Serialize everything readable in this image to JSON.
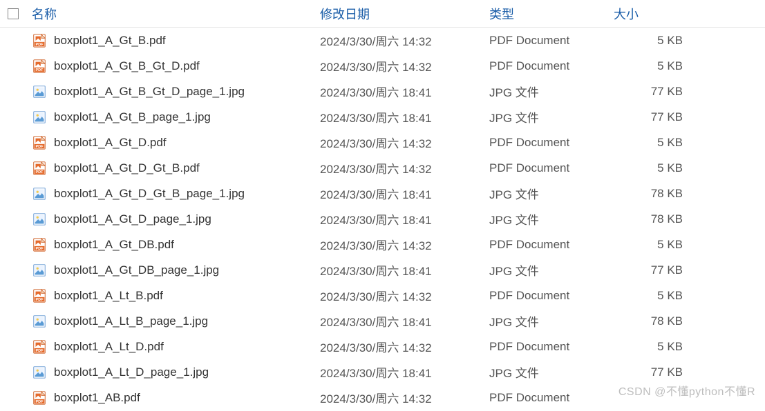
{
  "columns": {
    "name": "名称",
    "date": "修改日期",
    "type": "类型",
    "size": "大小"
  },
  "files": [
    {
      "icon": "pdf",
      "name": "boxplot1_A_Gt_B.pdf",
      "date": "2024/3/30/周六 14:32",
      "type": "PDF Document",
      "size": "5 KB"
    },
    {
      "icon": "pdf",
      "name": "boxplot1_A_Gt_B_Gt_D.pdf",
      "date": "2024/3/30/周六 14:32",
      "type": "PDF Document",
      "size": "5 KB"
    },
    {
      "icon": "jpg",
      "name": "boxplot1_A_Gt_B_Gt_D_page_1.jpg",
      "date": "2024/3/30/周六 18:41",
      "type": "JPG 文件",
      "size": "77 KB"
    },
    {
      "icon": "jpg",
      "name": "boxplot1_A_Gt_B_page_1.jpg",
      "date": "2024/3/30/周六 18:41",
      "type": "JPG 文件",
      "size": "77 KB"
    },
    {
      "icon": "pdf",
      "name": "boxplot1_A_Gt_D.pdf",
      "date": "2024/3/30/周六 14:32",
      "type": "PDF Document",
      "size": "5 KB"
    },
    {
      "icon": "pdf",
      "name": "boxplot1_A_Gt_D_Gt_B.pdf",
      "date": "2024/3/30/周六 14:32",
      "type": "PDF Document",
      "size": "5 KB"
    },
    {
      "icon": "jpg",
      "name": "boxplot1_A_Gt_D_Gt_B_page_1.jpg",
      "date": "2024/3/30/周六 18:41",
      "type": "JPG 文件",
      "size": "78 KB"
    },
    {
      "icon": "jpg",
      "name": "boxplot1_A_Gt_D_page_1.jpg",
      "date": "2024/3/30/周六 18:41",
      "type": "JPG 文件",
      "size": "78 KB"
    },
    {
      "icon": "pdf",
      "name": "boxplot1_A_Gt_DB.pdf",
      "date": "2024/3/30/周六 14:32",
      "type": "PDF Document",
      "size": "5 KB"
    },
    {
      "icon": "jpg",
      "name": "boxplot1_A_Gt_DB_page_1.jpg",
      "date": "2024/3/30/周六 18:41",
      "type": "JPG 文件",
      "size": "77 KB"
    },
    {
      "icon": "pdf",
      "name": "boxplot1_A_Lt_B.pdf",
      "date": "2024/3/30/周六 14:32",
      "type": "PDF Document",
      "size": "5 KB"
    },
    {
      "icon": "jpg",
      "name": "boxplot1_A_Lt_B_page_1.jpg",
      "date": "2024/3/30/周六 18:41",
      "type": "JPG 文件",
      "size": "78 KB"
    },
    {
      "icon": "pdf",
      "name": "boxplot1_A_Lt_D.pdf",
      "date": "2024/3/30/周六 14:32",
      "type": "PDF Document",
      "size": "5 KB"
    },
    {
      "icon": "jpg",
      "name": "boxplot1_A_Lt_D_page_1.jpg",
      "date": "2024/3/30/周六 18:41",
      "type": "JPG 文件",
      "size": "77 KB"
    },
    {
      "icon": "pdf",
      "name": "boxplot1_AB.pdf",
      "date": "2024/3/30/周六 14:32",
      "type": "PDF Document",
      "size": ""
    }
  ],
  "watermark": "CSDN @不懂python不懂R"
}
